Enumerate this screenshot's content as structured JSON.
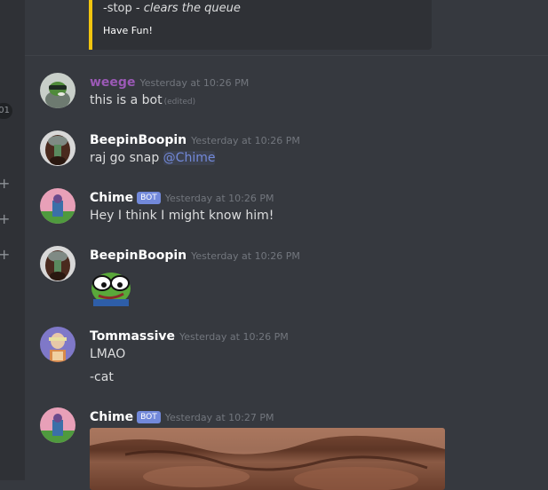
{
  "embed": {
    "line1_prefix": "-stop - ",
    "line1_italic": "clears the queue",
    "line2": "Have Fun!",
    "accent": "#f1c40f"
  },
  "strip": {
    "badge": "01"
  },
  "messages": [
    {
      "user": "weege",
      "user_color": "#9b59b6",
      "time": "Yesterday at 10:26 PM",
      "text": "this is a bot",
      "edited": "(edited)"
    },
    {
      "user": "BeepinBoopin",
      "user_color": "#ffffff",
      "time": "Yesterday at 10:26 PM",
      "text": "raj go snap ",
      "mention": "@Chime"
    },
    {
      "user": "Chime",
      "bot": "BOT",
      "user_color": "#ffffff",
      "time": "Yesterday at 10:26 PM",
      "text": "Hey I think I might know him!"
    },
    {
      "user": "BeepinBoopin",
      "user_color": "#ffffff",
      "time": "Yesterday at 10:26 PM",
      "emoji": "pepe-emoji"
    },
    {
      "user": "Tommassive",
      "user_color": "#ffffff",
      "time": "Yesterday at 10:26 PM",
      "text": "LMAO",
      "text2": "-cat"
    },
    {
      "user": "Chime",
      "bot": "BOT",
      "user_color": "#ffffff",
      "time": "Yesterday at 10:27 PM",
      "attachment": "cat-photo"
    }
  ],
  "colors": {
    "background": "#36393f",
    "mention": "#7289da",
    "bot_tag": "#7289da"
  }
}
